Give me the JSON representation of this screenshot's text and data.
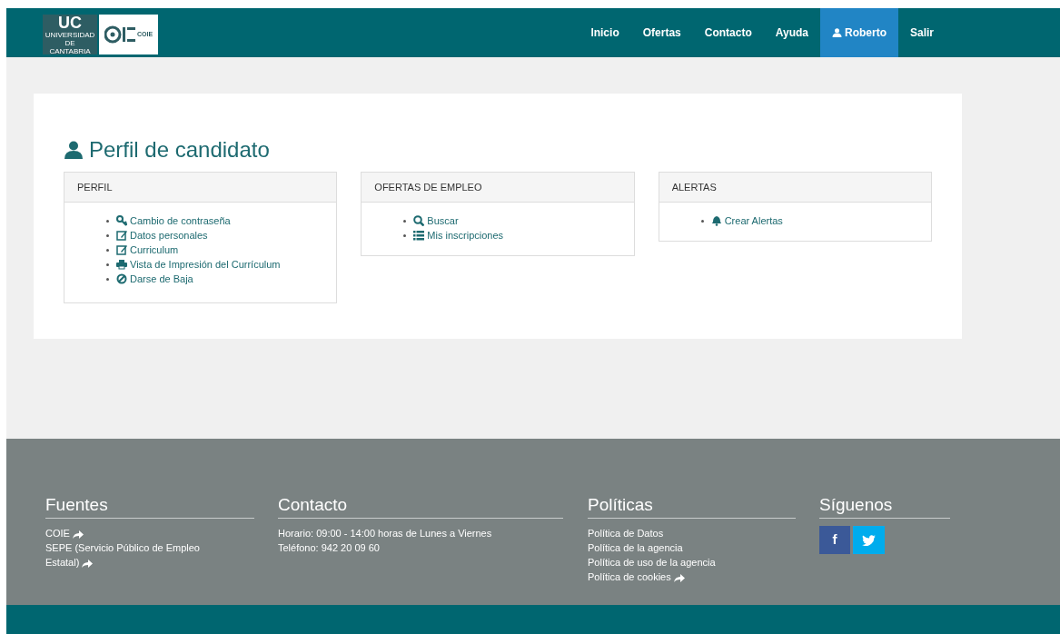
{
  "logo": {
    "uc": "UC",
    "university": "UNIVERSIDAD DE CANTABRIA",
    "coie": "COIE"
  },
  "nav": [
    {
      "label": "Inicio",
      "selected": false
    },
    {
      "label": "Ofertas",
      "selected": false
    },
    {
      "label": "Contacto",
      "selected": false
    },
    {
      "label": "Ayuda",
      "selected": false
    },
    {
      "label": "Roberto",
      "selected": true
    },
    {
      "label": "Salir",
      "selected": false
    }
  ],
  "page_title": "Perfil de candidato",
  "panels": [
    {
      "title": "PERFIL",
      "items": [
        "Cambio de contraseña",
        "Datos personales",
        "Curriculum",
        "Vista de Impresión del Currículum",
        "Darse de Baja"
      ]
    },
    {
      "title": "OFERTAS DE EMPLEO",
      "items": [
        "Buscar",
        "Mis inscripciones"
      ]
    },
    {
      "title": "ALERTAS",
      "items": [
        "Crear Alertas"
      ]
    }
  ],
  "footer": {
    "fuentes": {
      "title": "Fuentes",
      "links": [
        {
          "text": "COIE",
          "external": true
        },
        {
          "text": "SEPE (Servicio Público de Empleo Estatal)",
          "external": true
        }
      ]
    },
    "contacto": {
      "title": "Contacto",
      "lines": [
        "Horario: 09:00 - 14:00 horas de Lunes a Viernes",
        "Teléfono: 942 20 09 60"
      ]
    },
    "politicas": {
      "title": "Políticas",
      "links": [
        {
          "text": "Política de Datos",
          "external": false
        },
        {
          "text": "Política de la agencia",
          "external": false
        },
        {
          "text": "Política de uso de la agencia",
          "external": false
        },
        {
          "text": "Política de cookies",
          "external": true
        }
      ]
    },
    "siguenos": {
      "title": "Síguenos",
      "social": [
        "f"
      ]
    }
  }
}
